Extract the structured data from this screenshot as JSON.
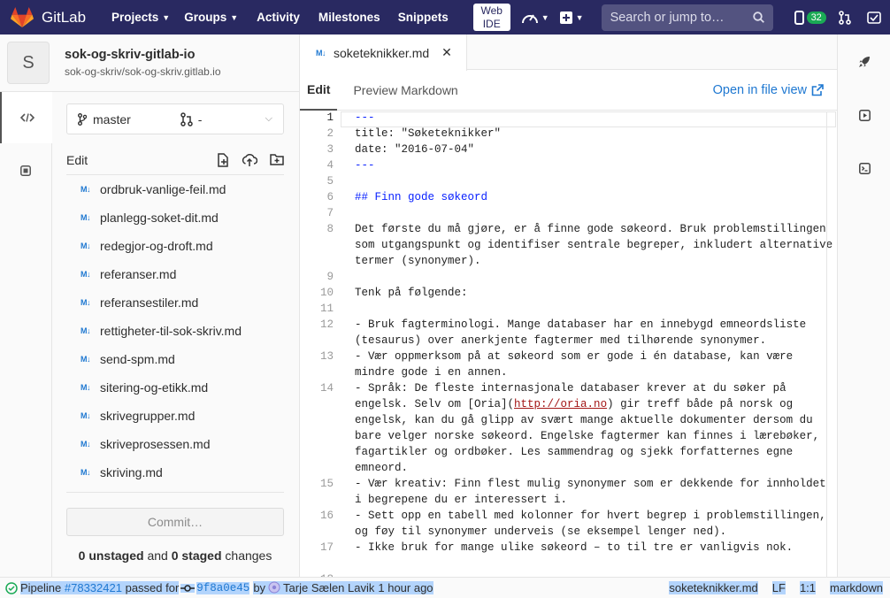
{
  "navbar": {
    "brand": "GitLab",
    "items": [
      {
        "label": "Projects",
        "dropdown": true
      },
      {
        "label": "Groups",
        "dropdown": true
      },
      {
        "label": "Activity",
        "dropdown": false
      },
      {
        "label": "Milestones",
        "dropdown": false
      },
      {
        "label": "Snippets",
        "dropdown": false
      }
    ],
    "webide_line1": "Web",
    "webide_line2": "IDE",
    "search_placeholder": "Search or jump to…",
    "todo_count": "32"
  },
  "project": {
    "avatar_letter": "S",
    "name": "sok-og-skriv-gitlab-io",
    "path": "sok-og-skriv/sok-og-skriv.gitlab.io"
  },
  "tree": {
    "branch": "master",
    "merge_request": "-",
    "header_label": "Edit",
    "files": [
      "ordbruk-vanlige-feil.md",
      "planlegg-soket-dit.md",
      "redegjor-og-droft.md",
      "referanser.md",
      "referansestiler.md",
      "rettigheter-til-sok-skriv.md",
      "send-spm.md",
      "sitering-og-etikk.md",
      "skrivegrupper.md",
      "skriveprosessen.md",
      "skriving.md"
    ],
    "commit_label": "Commit…",
    "unstaged_count": "0 unstaged",
    "and_text": " and ",
    "staged_count": "0 staged",
    "changes_text": " changes"
  },
  "editor": {
    "tab_name": "soketeknikker.md",
    "tab_edit": "Edit",
    "tab_preview": "Preview Markdown",
    "open_in_file_view": "Open in file view",
    "lines": [
      {
        "n": "1",
        "text": "---",
        "style": "blue"
      },
      {
        "n": "2",
        "text": "title: \"Søketeknikker\"",
        "style": ""
      },
      {
        "n": "3",
        "text": "date: \"2016-07-04\"",
        "style": ""
      },
      {
        "n": "4",
        "text": "---",
        "style": "blue"
      },
      {
        "n": "5",
        "text": "",
        "style": ""
      },
      {
        "n": "6",
        "text": "## Finn gode søkeord",
        "style": "blue"
      },
      {
        "n": "7",
        "text": "",
        "style": ""
      },
      {
        "n": "8",
        "text": "Det første du må gjøre, er å finne gode søkeord. Bruk problemstillingen",
        "style": ""
      },
      {
        "n": "",
        "text": "som utgangspunkt og identifiser sentrale begreper, inkludert alternative",
        "style": ""
      },
      {
        "n": "",
        "text": "termer (synonymer).",
        "style": ""
      },
      {
        "n": "9",
        "text": "",
        "style": ""
      },
      {
        "n": "10",
        "text": "Tenk på følgende:",
        "style": ""
      },
      {
        "n": "11",
        "text": "",
        "style": ""
      },
      {
        "n": "12",
        "text": "- Bruk fagterminologi. Mange databaser har en innebygd emneordsliste",
        "style": ""
      },
      {
        "n": "",
        "text": "(tesaurus) over anerkjente fagtermer med tilhørende synonymer.",
        "style": ""
      },
      {
        "n": "13",
        "text": "- Vær oppmerksom på at søkeord som er gode i én database, kan være",
        "style": ""
      },
      {
        "n": "",
        "text": "mindre gode i en annen.",
        "style": ""
      },
      {
        "n": "14",
        "text": "- Språk: De fleste internasjonale databaser krever at du søker på",
        "style": ""
      },
      {
        "n": "",
        "text": "engelsk. Selv om [Oria](http://oria.no) gir treff både på norsk og",
        "style": "link"
      },
      {
        "n": "",
        "text": "engelsk, kan du gå glipp av svært mange aktuelle dokumenter dersom du",
        "style": ""
      },
      {
        "n": "",
        "text": "bare velger norske søkeord. Engelske fagtermer kan finnes i lærebøker,",
        "style": ""
      },
      {
        "n": "",
        "text": "fagartikler og ordbøker. Les sammendrag og sjekk forfatternes egne",
        "style": ""
      },
      {
        "n": "",
        "text": "emneord.",
        "style": ""
      },
      {
        "n": "15",
        "text": "- Vær kreativ: Finn flest mulig synonymer som er dekkende for innholdet",
        "style": ""
      },
      {
        "n": "",
        "text": "i begrepene du er interessert i.",
        "style": ""
      },
      {
        "n": "16",
        "text": "- Sett opp en tabell med kolonner for hvert begrep i problemstillingen,",
        "style": ""
      },
      {
        "n": "",
        "text": "og føy til synonymer underveis (se eksempel lenger ned).",
        "style": ""
      },
      {
        "n": "17",
        "text": "- Ikke bruk for mange ulike søkeord – to til tre er vanligvis nok.",
        "style": ""
      },
      {
        "n": "",
        "text": "",
        "style": ""
      },
      {
        "n": "18",
        "text": "",
        "style": ""
      }
    ],
    "link_parts": {
      "before": "engelsk. Selv om ",
      "bracket_open": "[Oria](",
      "url": "http://oria.no",
      "bracket_close": ")",
      "after": " gir treff både på norsk og"
    }
  },
  "statusbar": {
    "pipeline_label": "Pipeline",
    "pipeline_id": "#78332421",
    "pipeline_status": "passed for",
    "commit_sha": "9f8a0e45",
    "by": "by",
    "author": "Tarje Sælen Lavik",
    "time": "1 hour ago",
    "file": "soketeknikker.md",
    "eol": "LF",
    "position": "1:1",
    "language": "markdown"
  },
  "colors": {
    "navbar": "#292961",
    "link": "#1f78d1",
    "success": "#1aaa55",
    "selection": "#b3d4fc"
  }
}
